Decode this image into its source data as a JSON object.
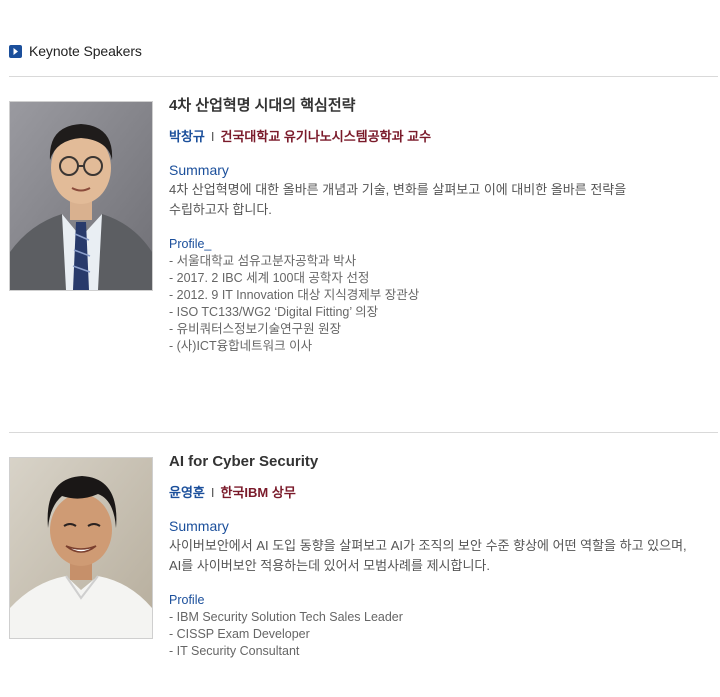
{
  "section": {
    "title": "Keynote Speakers"
  },
  "speakers": [
    {
      "talk_title": "4차 산업혁명 시대의 핵심전략",
      "name": "박창규",
      "separator": "I",
      "affiliation": "건국대학교 유기나노시스템공학과 교수",
      "summary_label": "Summary",
      "summary_line1": "4차 산업혁명에 대한 올바른 개념과 기술, 변화를 살펴보고 이에 대비한 올바른 전략을",
      "summary_line2": "수립하고자 합니다.",
      "profile_label": "Profile_",
      "profile": [
        "- 서울대학교 섬유고분자공학과 박사",
        "- 2017. 2 IBC 세계 100대 공학자 선정",
        "- 2012. 9 IT Innovation 대상 지식경제부 장관상",
        "- ISO TC133/WG2 ‘Digital Fitting’ 의장",
        "- 유비쿼터스정보기술연구원 원장",
        "- (사)ICT융합네트워크 이사"
      ]
    },
    {
      "talk_title": "AI for Cyber Security",
      "name": "윤영훈",
      "separator": "I",
      "affiliation": "한국IBM 상무",
      "summary_label": "Summary",
      "summary_line1": "사이버보안에서 AI 도입 동향을 살펴보고 AI가 조직의 보안 수준 향상에 어떤 역할을 하고 있으며,",
      "summary_line2": "AI를 사이버보안 적용하는데 있어서 모범사례를 제시합니다.",
      "profile_label": "Profile",
      "profile": [
        "- IBM Security Solution Tech Sales Leader",
        "- CISSP Exam Developer",
        "- IT Security Consultant"
      ]
    }
  ]
}
